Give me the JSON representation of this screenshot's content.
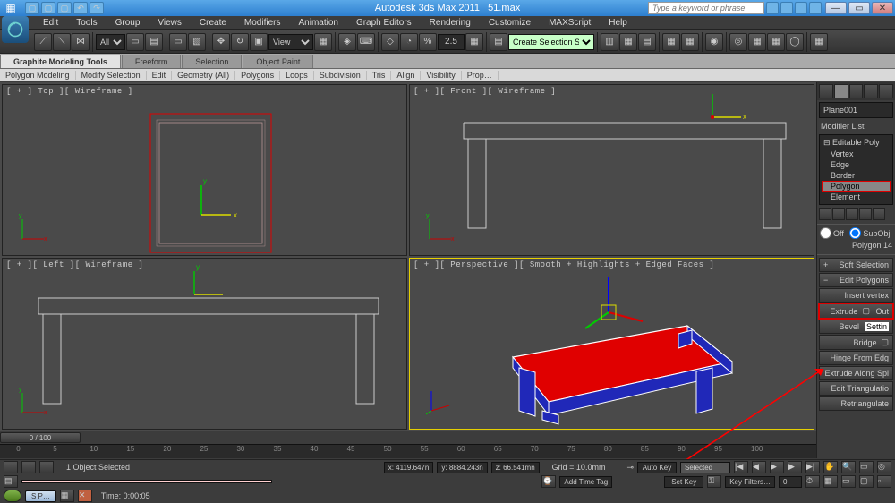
{
  "titlebar": {
    "app_name": "Autodesk 3ds Max 2011",
    "filename": "51.max",
    "search_placeholder": "Type a keyword or phrase"
  },
  "menubar": [
    "Edit",
    "Tools",
    "Group",
    "Views",
    "Create",
    "Modifiers",
    "Animation",
    "Graph Editors",
    "Rendering",
    "Customize",
    "MAXScript",
    "Help"
  ],
  "toolbar": {
    "select_filter": "All",
    "view_mode": "View",
    "axis_value": "2.5",
    "selection_set": "Create Selection Set"
  },
  "ribbon_tabs": [
    "Graphite Modeling Tools",
    "Freeform",
    "Selection",
    "Object Paint"
  ],
  "sub_ribbon": [
    "Polygon Modeling",
    "Modify Selection",
    "Edit",
    "Geometry (All)",
    "Polygons",
    "Loops",
    "Subdivision",
    "Tris",
    "Align",
    "Visibility",
    "Prop…"
  ],
  "viewports": {
    "top": "[ + ] Top ][ Wireframe ]",
    "front": "[ + ][ Front ][ Wireframe ]",
    "left": "[ + ][ Left ][ Wireframe ]",
    "perspective": "[ + ][ Perspective ][ Smooth + Highlights + Edged Faces ]"
  },
  "timeline": {
    "slider_label": "0 / 100",
    "ticks": [
      "0",
      "5",
      "10",
      "15",
      "20",
      "25",
      "30",
      "35",
      "40",
      "45",
      "50",
      "55",
      "60",
      "65",
      "70",
      "75",
      "80",
      "85",
      "90",
      "95",
      "100"
    ]
  },
  "cmdpanel": {
    "object_name": "Plane001",
    "modifier_list_label": "Modifier List",
    "stack_root": "Editable Poly",
    "subobjects": [
      "Vertex",
      "Edge",
      "Border",
      "Polygon",
      "Element"
    ],
    "selected_subobject": "Polygon",
    "off_label": "Off",
    "subobj_label": "SubObj",
    "polygon_id": "Polygon 14",
    "rollouts": {
      "soft_selection": "Soft Selection",
      "edit_polygons": "Edit Polygons",
      "insert_vertex": "Insert vertex",
      "extrude": "Extrude",
      "outline": "Out",
      "bevel": "Bevel",
      "setting": "Settin",
      "bridge": "Bridge",
      "hinge": "Hinge From Edg",
      "extrude_spline": "Extrude Along Spl",
      "edit_tri": "Edit Triangulatio",
      "retri": "Retriangulate"
    }
  },
  "status": {
    "selected": "1 Object Selected",
    "coords": {
      "x": "x: 4119.647n",
      "y": "y: 8884.243n",
      "z": "z: 66.541mn"
    },
    "grid": "Grid = 10.0mm",
    "autokey": "Auto Key",
    "setkey": "Set Key",
    "selected_btn": "Selected",
    "keyfilters": "Key Filters…",
    "addtimetag": "Add Time Tag",
    "time": "Time: 0:00:05",
    "task": "S P…"
  }
}
